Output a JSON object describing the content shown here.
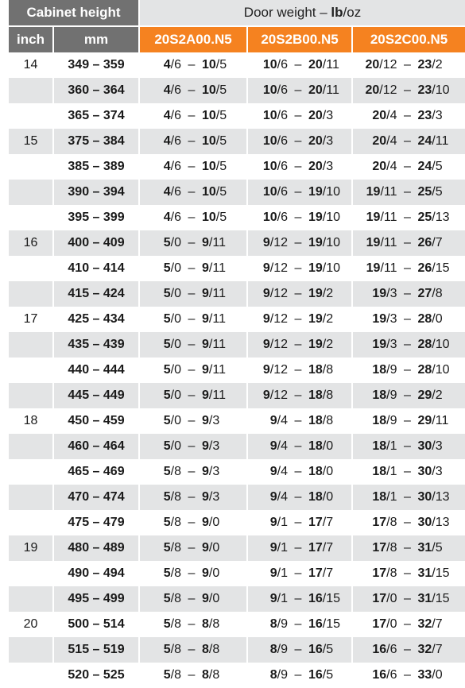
{
  "header": {
    "cabinet_height": "Cabinet height",
    "door_weight_prefix": "Door weight – ",
    "door_weight_unit_bold": "lb",
    "door_weight_unit_rest": "/oz",
    "col_inch": "inch",
    "col_mm": "mm",
    "models": [
      "20S2A00.N5",
      "20S2B00.N5",
      "20S2C00.N5"
    ]
  },
  "colors": {
    "header_gray": "#717171",
    "header_light": "#e3e4e5",
    "accent_orange": "#f58220",
    "row_alt": "#e3e4e5"
  },
  "rows": [
    {
      "inch": "14",
      "mm": "349 – 359",
      "a": [
        "4/6",
        "10/5"
      ],
      "b": [
        "10/6",
        "20/11"
      ],
      "c": [
        "20/12",
        "23/2"
      ]
    },
    {
      "inch": "",
      "mm": "360 – 364",
      "a": [
        "4/6",
        "10/5"
      ],
      "b": [
        "10/6",
        "20/11"
      ],
      "c": [
        "20/12",
        "23/10"
      ]
    },
    {
      "inch": "",
      "mm": "365 – 374",
      "a": [
        "4/6",
        "10/5"
      ],
      "b": [
        "10/6",
        "20/3"
      ],
      "c": [
        "20/4",
        "23/3"
      ]
    },
    {
      "inch": "15",
      "mm": "375 – 384",
      "a": [
        "4/6",
        "10/5"
      ],
      "b": [
        "10/6",
        "20/3"
      ],
      "c": [
        "20/4",
        "24/11"
      ]
    },
    {
      "inch": "",
      "mm": "385 – 389",
      "a": [
        "4/6",
        "10/5"
      ],
      "b": [
        "10/6",
        "20/3"
      ],
      "c": [
        "20/4",
        "24/5"
      ]
    },
    {
      "inch": "",
      "mm": "390 – 394",
      "a": [
        "4/6",
        "10/5"
      ],
      "b": [
        "10/6",
        "19/10"
      ],
      "c": [
        "19/11",
        "25/5"
      ]
    },
    {
      "inch": "",
      "mm": "395 – 399",
      "a": [
        "4/6",
        "10/5"
      ],
      "b": [
        "10/6",
        "19/10"
      ],
      "c": [
        "19/11",
        "25/13"
      ]
    },
    {
      "inch": "16",
      "mm": "400 – 409",
      "a": [
        "5/0",
        "9/11"
      ],
      "b": [
        "9/12",
        "19/10"
      ],
      "c": [
        "19/11",
        "26/7"
      ]
    },
    {
      "inch": "",
      "mm": "410 – 414",
      "a": [
        "5/0",
        "9/11"
      ],
      "b": [
        "9/12",
        "19/10"
      ],
      "c": [
        "19/11",
        "26/15"
      ]
    },
    {
      "inch": "",
      "mm": "415 – 424",
      "a": [
        "5/0",
        "9/11"
      ],
      "b": [
        "9/12",
        "19/2"
      ],
      "c": [
        "19/3",
        "27/8"
      ]
    },
    {
      "inch": "17",
      "mm": "425 – 434",
      "a": [
        "5/0",
        "9/11"
      ],
      "b": [
        "9/12",
        "19/2"
      ],
      "c": [
        "19/3",
        "28/0"
      ]
    },
    {
      "inch": "",
      "mm": "435 – 439",
      "a": [
        "5/0",
        "9/11"
      ],
      "b": [
        "9/12",
        "19/2"
      ],
      "c": [
        "19/3",
        "28/10"
      ]
    },
    {
      "inch": "",
      "mm": "440 – 444",
      "a": [
        "5/0",
        "9/11"
      ],
      "b": [
        "9/12",
        "18/8"
      ],
      "c": [
        "18/9",
        "28/10"
      ]
    },
    {
      "inch": "",
      "mm": "445 – 449",
      "a": [
        "5/0",
        "9/11"
      ],
      "b": [
        "9/12",
        "18/8"
      ],
      "c": [
        "18/9",
        "29/2"
      ]
    },
    {
      "inch": "18",
      "mm": "450 – 459",
      "a": [
        "5/0",
        "9/3"
      ],
      "b": [
        "9/4",
        "18/8"
      ],
      "c": [
        "18/9",
        "29/11"
      ]
    },
    {
      "inch": "",
      "mm": "460 – 464",
      "a": [
        "5/0",
        "9/3"
      ],
      "b": [
        "9/4",
        "18/0"
      ],
      "c": [
        "18/1",
        "30/3"
      ]
    },
    {
      "inch": "",
      "mm": "465 – 469",
      "a": [
        "5/8",
        "9/3"
      ],
      "b": [
        "9/4",
        "18/0"
      ],
      "c": [
        "18/1",
        "30/3"
      ]
    },
    {
      "inch": "",
      "mm": "470 – 474",
      "a": [
        "5/8",
        "9/3"
      ],
      "b": [
        "9/4",
        "18/0"
      ],
      "c": [
        "18/1",
        "30/13"
      ]
    },
    {
      "inch": "",
      "mm": "475 – 479",
      "a": [
        "5/8",
        "9/0"
      ],
      "b": [
        "9/1",
        "17/7"
      ],
      "c": [
        "17/8",
        "30/13"
      ]
    },
    {
      "inch": "19",
      "mm": "480 – 489",
      "a": [
        "5/8",
        "9/0"
      ],
      "b": [
        "9/1",
        "17/7"
      ],
      "c": [
        "17/8",
        "31/5"
      ]
    },
    {
      "inch": "",
      "mm": "490 – 494",
      "a": [
        "5/8",
        "9/0"
      ],
      "b": [
        "9/1",
        "17/7"
      ],
      "c": [
        "17/8",
        "31/15"
      ]
    },
    {
      "inch": "",
      "mm": "495 – 499",
      "a": [
        "5/8",
        "9/0"
      ],
      "b": [
        "9/1",
        "16/15"
      ],
      "c": [
        "17/0",
        "31/15"
      ]
    },
    {
      "inch": "20",
      "mm": "500 – 514",
      "a": [
        "5/8",
        "8/8"
      ],
      "b": [
        "8/9",
        "16/15"
      ],
      "c": [
        "17/0",
        "32/7"
      ]
    },
    {
      "inch": "",
      "mm": "515 – 519",
      "a": [
        "5/8",
        "8/8"
      ],
      "b": [
        "8/9",
        "16/5"
      ],
      "c": [
        "16/6",
        "32/7"
      ]
    },
    {
      "inch": "",
      "mm": "520 – 525",
      "a": [
        "5/8",
        "8/8"
      ],
      "b": [
        "8/9",
        "16/5"
      ],
      "c": [
        "16/6",
        "33/0"
      ]
    }
  ],
  "range_separator": "–"
}
